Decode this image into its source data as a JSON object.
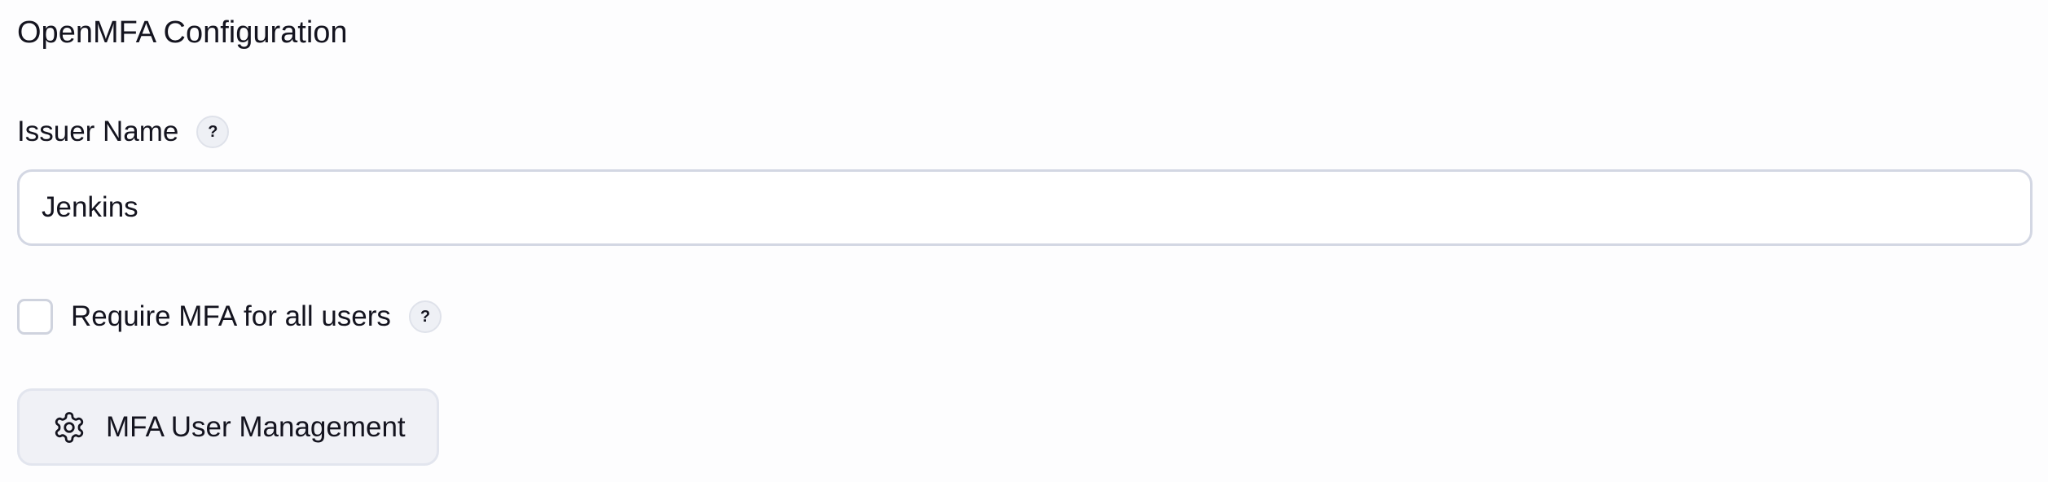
{
  "section": {
    "title": "OpenMFA Configuration"
  },
  "issuer": {
    "label": "Issuer Name",
    "help": "?",
    "value": "Jenkins"
  },
  "require_mfa": {
    "label": "Require MFA for all users",
    "help": "?",
    "checked": false
  },
  "user_management": {
    "label": "MFA User Management",
    "icon": "gear-icon"
  }
}
